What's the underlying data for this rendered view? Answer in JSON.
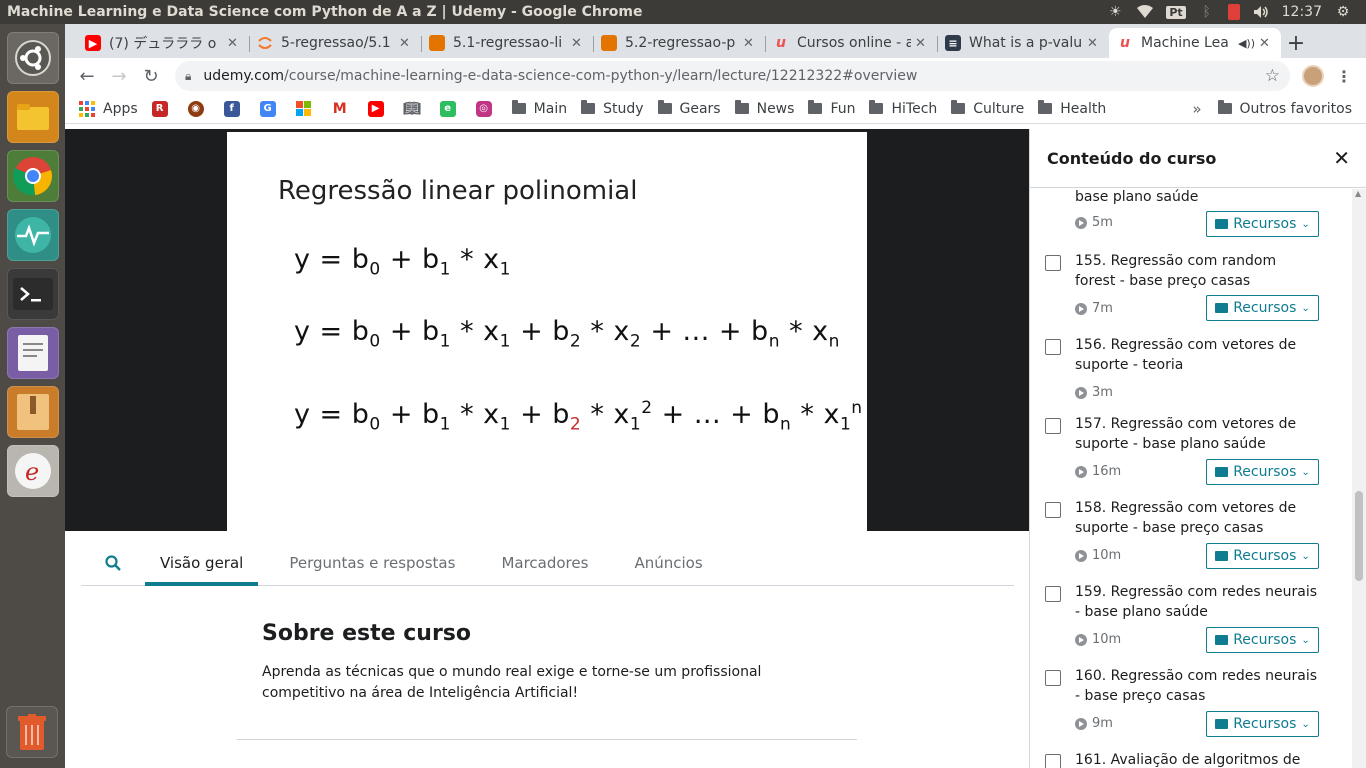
{
  "panel": {
    "window_title": "Machine Learning e Data Science com Python de A a Z | Udemy - Google Chrome",
    "keyboard_layout": "Pt",
    "clock": "12:37"
  },
  "launcher": {
    "items": [
      "ubuntu-dash",
      "files",
      "chrome",
      "system-monitor",
      "terminal",
      "text-editor",
      "archive-manager",
      "ebook-reader"
    ],
    "trash": "trash"
  },
  "tabs": [
    {
      "label": "(7) デュラララ o",
      "icon": "youtube-icon",
      "color": "#ff0000"
    },
    {
      "label": "5-regressao/5.1",
      "icon": "jupyter-icon",
      "color": "#f37726"
    },
    {
      "label": "5.1-regressao-li",
      "icon": "book-icon",
      "color": "#e37400"
    },
    {
      "label": "5.2-regressao-p",
      "icon": "book-icon",
      "color": "#e37400"
    },
    {
      "label": "Cursos online - a",
      "icon": "udemy-icon",
      "color": "#a435f0"
    },
    {
      "label": "What is a p-valu",
      "icon": "stackexchange-icon",
      "color": "#2f3b4a"
    },
    {
      "label": "Machine Lea",
      "icon": "udemy-icon",
      "color": "#ec5252"
    }
  ],
  "toolbar": {
    "url_host": "udemy.com",
    "url_path": "/course/machine-learning-e-data-science-com-python-y/learn/lecture/12212322#overview"
  },
  "bookmarks": {
    "apps_label": "Apps",
    "folders": [
      "Main",
      "Study",
      "Gears",
      "News",
      "Fun",
      "HiTech",
      "Culture",
      "Health"
    ],
    "other_label": "Outros favoritos",
    "more_label": "»"
  },
  "slide": {
    "title": "Regressão linear polinomial"
  },
  "course_tabs": [
    "Visão geral",
    "Perguntas e respostas",
    "Marcadores",
    "Anúncios"
  ],
  "about": {
    "heading": "Sobre este curso",
    "text": "Aprenda as técnicas que o mundo real exige e torne-se um profissional competitivo na área de Inteligência Artificial!"
  },
  "sidebar": {
    "title": "Conteúdo do curso",
    "resource_label": "Recursos",
    "items": [
      {
        "title": "base plano saúde",
        "duration": "5m",
        "has_resources": true,
        "partial": true
      },
      {
        "title": "155. Regressão com random forest - base preço casas",
        "duration": "7m",
        "has_resources": true
      },
      {
        "title": "156. Regressão com vetores de suporte - teoria",
        "duration": "3m",
        "has_resources": false
      },
      {
        "title": "157. Regressão com vetores de suporte - base plano saúde",
        "duration": "16m",
        "has_resources": true
      },
      {
        "title": "158. Regressão com vetores de suporte - base preço casas",
        "duration": "10m",
        "has_resources": true
      },
      {
        "title": "159. Regressão com redes neurais - base plano saúde",
        "duration": "10m",
        "has_resources": true
      },
      {
        "title": "160. Regressão com redes neurais - base preço casas",
        "duration": "9m",
        "has_resources": true
      },
      {
        "title": "161. Avaliação de algoritmos de",
        "duration": "",
        "has_resources": false
      }
    ]
  }
}
